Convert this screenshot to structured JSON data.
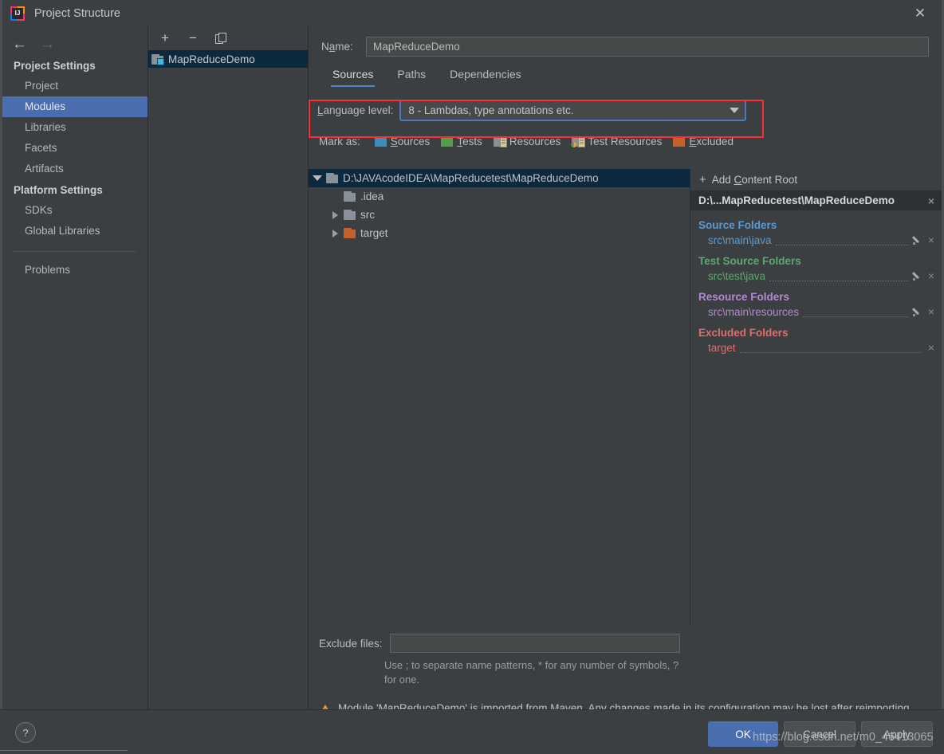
{
  "window": {
    "title": "Project Structure",
    "app_icon": "intellij-idea-icon",
    "close_icon": "✕"
  },
  "nav": {
    "back_icon": "←",
    "forward_icon": "→"
  },
  "sidebar": {
    "groups": [
      {
        "title": "Project Settings",
        "items": [
          {
            "label": "Project",
            "selected": false
          },
          {
            "label": "Modules",
            "selected": true
          },
          {
            "label": "Libraries",
            "selected": false
          },
          {
            "label": "Facets",
            "selected": false
          },
          {
            "label": "Artifacts",
            "selected": false
          }
        ]
      },
      {
        "title": "Platform Settings",
        "items": [
          {
            "label": "SDKs",
            "selected": false
          },
          {
            "label": "Global Libraries",
            "selected": false
          }
        ]
      }
    ],
    "problems_label": "Problems"
  },
  "module_list": {
    "toolbar": {
      "add_label": "+",
      "remove_label": "−",
      "copy_label": "copy-icon"
    },
    "modules": [
      {
        "name": "MapReduceDemo",
        "selected": true
      }
    ]
  },
  "main": {
    "name_label": "Name:",
    "name_mnemonic": "a",
    "name_value": "MapReduceDemo",
    "tabs": [
      {
        "label": "Sources",
        "active": true
      },
      {
        "label": "Paths",
        "active": false
      },
      {
        "label": "Dependencies",
        "active": false
      }
    ],
    "language_level": {
      "label": "Language level:",
      "mnemonic": "L",
      "value": "8 - Lambdas, type annotations etc.",
      "highlight_color": "#fe2e2e"
    },
    "mark_as": {
      "label": "Mark as:",
      "options": [
        {
          "label": "Sources",
          "mnemonic": "S",
          "icon": "folder-blue-icon",
          "color": "#3b8eb5"
        },
        {
          "label": "Tests",
          "mnemonic": "T",
          "icon": "folder-green-icon",
          "color": "#539e4a"
        },
        {
          "label": "Resources",
          "mnemonic": "",
          "icon": "folder-resources-icon",
          "color": "#8a9097"
        },
        {
          "label": "Test Resources",
          "mnemonic": "",
          "icon": "folder-test-resources-icon",
          "color": "#8a9097"
        },
        {
          "label": "Excluded",
          "mnemonic": "E",
          "icon": "folder-orange-icon",
          "color": "#c3632c"
        }
      ]
    },
    "tree": [
      {
        "label": "D:\\JAVAcodeIDEA\\MapReducetest\\MapReduceDemo",
        "indent": 0,
        "twisty": "down",
        "icon": "folder-gray-icon",
        "selected": true
      },
      {
        "label": ".idea",
        "indent": 1,
        "twisty": "none",
        "icon": "folder-gray-icon",
        "selected": false
      },
      {
        "label": "src",
        "indent": 1,
        "twisty": "right",
        "icon": "folder-gray-icon",
        "selected": false
      },
      {
        "label": "target",
        "indent": 1,
        "twisty": "right",
        "icon": "folder-orange-icon",
        "selected": false
      }
    ],
    "content_roots": {
      "add_label": "Add Content Root",
      "add_mnemonic": "C",
      "root_title": "D:\\...MapReducetest\\MapReduceDemo",
      "close_icon": "×",
      "groups": [
        {
          "title": "Source Folders",
          "color": "#5b9bd5",
          "paths": [
            {
              "path": "src\\main\\java",
              "has_edit": true
            }
          ]
        },
        {
          "title": "Test Source Folders",
          "color": "#5aa86e",
          "paths": [
            {
              "path": "src\\test\\java",
              "has_edit": true
            }
          ]
        },
        {
          "title": "Resource Folders",
          "color": "#b18ad1",
          "paths": [
            {
              "path": "src\\main\\resources",
              "has_edit": true
            }
          ]
        },
        {
          "title": "Excluded Folders",
          "color": "#e06c6c",
          "paths": [
            {
              "path": "target",
              "has_edit": false
            }
          ]
        }
      ]
    },
    "exclude_files": {
      "label": "Exclude files:",
      "value": "",
      "hint": "Use ; to separate name patterns, * for any number of symbols, ? for one."
    },
    "warning": {
      "icon": "warning-icon",
      "text": "Module 'MapReduceDemo' is imported from Maven. Any changes made in its configuration may be lost after reimporting."
    }
  },
  "footer": {
    "help_label": "?",
    "ok_label": "OK",
    "cancel_label": "Cancel",
    "apply_label": "Apply",
    "watermark": "https://blog.csdn.net/m0_46413065"
  }
}
